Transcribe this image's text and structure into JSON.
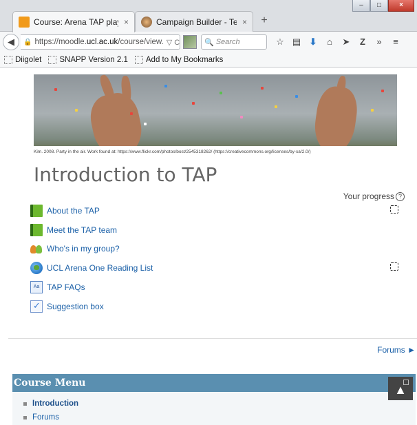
{
  "browser": {
    "tabs": [
      {
        "title": "Course: Arena TAP plaype...",
        "close": "×",
        "active": true
      },
      {
        "title": "Campaign Builder - Templ...",
        "close": "×",
        "active": false
      }
    ],
    "new_tab": "+",
    "window_controls": {
      "minimize": "–",
      "maximize": "□",
      "close": "×"
    },
    "url_prefix": "https://moodle.",
    "url_domain": "ucl.ac.uk",
    "url_suffix": "/course/view.",
    "url_tail": "▽ C",
    "search_placeholder": "Search",
    "toolbar_icons": [
      "star-icon",
      "clipboard-icon",
      "download-icon",
      "home-icon",
      "send-icon",
      "zotero-icon",
      "overflow-icon",
      "menu-icon"
    ],
    "bookmarks": [
      "Diigolet",
      "SNAPP Version 2.1",
      "Add to My Bookmarks"
    ]
  },
  "page": {
    "image_caption": "Kim. 2008. Party in the air. Work found at: https://www.flickr.com/photos/bost/2545318262/ (https://creativecommons.org/licenses/by-sa/2.0/)",
    "title": "Introduction to TAP",
    "progress_label": "Your progress",
    "progress_help": "?",
    "activities": [
      {
        "label": "About the TAP",
        "icon": "book-icon",
        "tracked": true
      },
      {
        "label": "Meet the TAP team",
        "icon": "book-icon",
        "tracked": false
      },
      {
        "label": "Who's in my group?",
        "icon": "group-icon",
        "tracked": false
      },
      {
        "label": "UCL Arena One Reading List",
        "icon": "globe-icon",
        "tracked": true
      },
      {
        "label": "TAP FAQs",
        "icon": "glossary-icon",
        "tracked": false
      },
      {
        "label": "Suggestion box",
        "icon": "feedback-icon",
        "tracked": false
      }
    ],
    "forums_link": "Forums ►",
    "course_menu": {
      "title": "Course Menu",
      "items": [
        {
          "label": "Introduction",
          "active": true
        },
        {
          "label": "Forums",
          "active": false
        }
      ]
    },
    "scroll_top_label": "▲"
  },
  "colors": {
    "link": "#1c61a8",
    "menu_header": "#5a8fb0",
    "title_grey": "#666666"
  }
}
